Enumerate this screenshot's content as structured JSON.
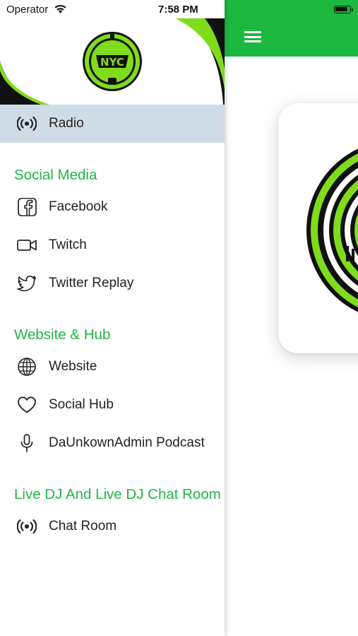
{
  "status_bar": {
    "carrier": "Operator",
    "time": "7:58 PM"
  },
  "colors": {
    "brand_green": "#1db83f",
    "section_green": "#22b548",
    "active_row": "#d0dce5",
    "logo_lime": "#7fdc1b"
  },
  "logo": {
    "text": "NYC"
  },
  "drawer": {
    "radio": {
      "label": "Radio",
      "icon": "radio-broadcast-icon",
      "active": true
    },
    "social_media": {
      "title": "Social Media",
      "items": [
        {
          "label": "Facebook",
          "icon": "facebook-icon"
        },
        {
          "label": "Twitch",
          "icon": "video-camera-icon"
        },
        {
          "label": "Twitter Replay",
          "icon": "twitter-bird-icon"
        }
      ]
    },
    "website_hub": {
      "title": "Website & Hub",
      "items": [
        {
          "label": "Website",
          "icon": "globe-icon"
        },
        {
          "label": "Social Hub",
          "icon": "heart-icon"
        },
        {
          "label": "DaUnkownAdmin Podcast",
          "icon": "microphone-icon"
        }
      ]
    },
    "live_dj": {
      "title": "Live DJ And Live DJ Chat Room",
      "items": [
        {
          "label": "Chat Room",
          "icon": "radio-broadcast-icon"
        }
      ]
    }
  },
  "main": {
    "menu_icon": "hamburger-menu-icon"
  }
}
